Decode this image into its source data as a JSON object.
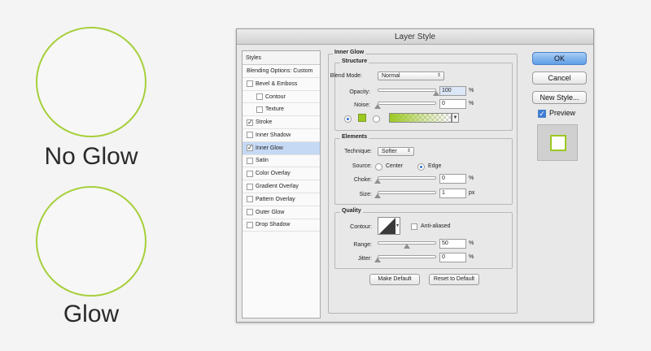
{
  "demo": {
    "no_glow_label": "No Glow",
    "glow_label": "Glow"
  },
  "dialog": {
    "title": "Layer Style",
    "styles_header": "Styles",
    "styles_list": [
      {
        "label": "Blending Options: Custom",
        "checkbox": false,
        "checked": false,
        "indent": false,
        "selected": false
      },
      {
        "label": "Bevel & Emboss",
        "checkbox": true,
        "checked": false,
        "indent": false,
        "selected": false
      },
      {
        "label": "Contour",
        "checkbox": true,
        "checked": false,
        "indent": true,
        "selected": false
      },
      {
        "label": "Texture",
        "checkbox": true,
        "checked": false,
        "indent": true,
        "selected": false
      },
      {
        "label": "Stroke",
        "checkbox": true,
        "checked": true,
        "indent": false,
        "selected": false
      },
      {
        "label": "Inner Shadow",
        "checkbox": true,
        "checked": false,
        "indent": false,
        "selected": false
      },
      {
        "label": "Inner Glow",
        "checkbox": true,
        "checked": true,
        "indent": false,
        "selected": true
      },
      {
        "label": "Satin",
        "checkbox": true,
        "checked": false,
        "indent": false,
        "selected": false
      },
      {
        "label": "Color Overlay",
        "checkbox": true,
        "checked": false,
        "indent": false,
        "selected": false
      },
      {
        "label": "Gradient Overlay",
        "checkbox": true,
        "checked": false,
        "indent": false,
        "selected": false
      },
      {
        "label": "Pattern Overlay",
        "checkbox": true,
        "checked": false,
        "indent": false,
        "selected": false
      },
      {
        "label": "Outer Glow",
        "checkbox": true,
        "checked": false,
        "indent": false,
        "selected": false
      },
      {
        "label": "Drop Shadow",
        "checkbox": true,
        "checked": false,
        "indent": false,
        "selected": false
      }
    ],
    "inner_glow": {
      "title": "Inner Glow",
      "structure": {
        "title": "Structure",
        "blend_mode_label": "Blend Mode:",
        "blend_mode_value": "Normal",
        "opacity_label": "Opacity:",
        "opacity_value": "100",
        "opacity_level": 1.0,
        "noise_label": "Noise:",
        "noise_value": "0",
        "noise_level": 0.0,
        "percent": "%",
        "glow_color": "#9cc820"
      },
      "elements": {
        "title": "Elements",
        "technique_label": "Technique:",
        "technique_value": "Softer",
        "source_label": "Source:",
        "source_center": "Center",
        "source_edge": "Edge",
        "choke_label": "Choke:",
        "choke_value": "0",
        "choke_level": 0.0,
        "size_label": "Size:",
        "size_value": "1",
        "size_level": 0.0,
        "percent": "%",
        "px": "px"
      },
      "quality": {
        "title": "Quality",
        "contour_label": "Contour:",
        "anti_aliased_label": "Anti-aliased",
        "range_label": "Range:",
        "range_value": "50",
        "range_level": 0.5,
        "jitter_label": "Jitter:",
        "jitter_value": "0",
        "jitter_level": 0.0,
        "percent": "%"
      },
      "make_default": "Make Default",
      "reset_default": "Reset to Default"
    },
    "ok": "OK",
    "cancel": "Cancel",
    "new_style": "New Style...",
    "preview": "Preview"
  }
}
